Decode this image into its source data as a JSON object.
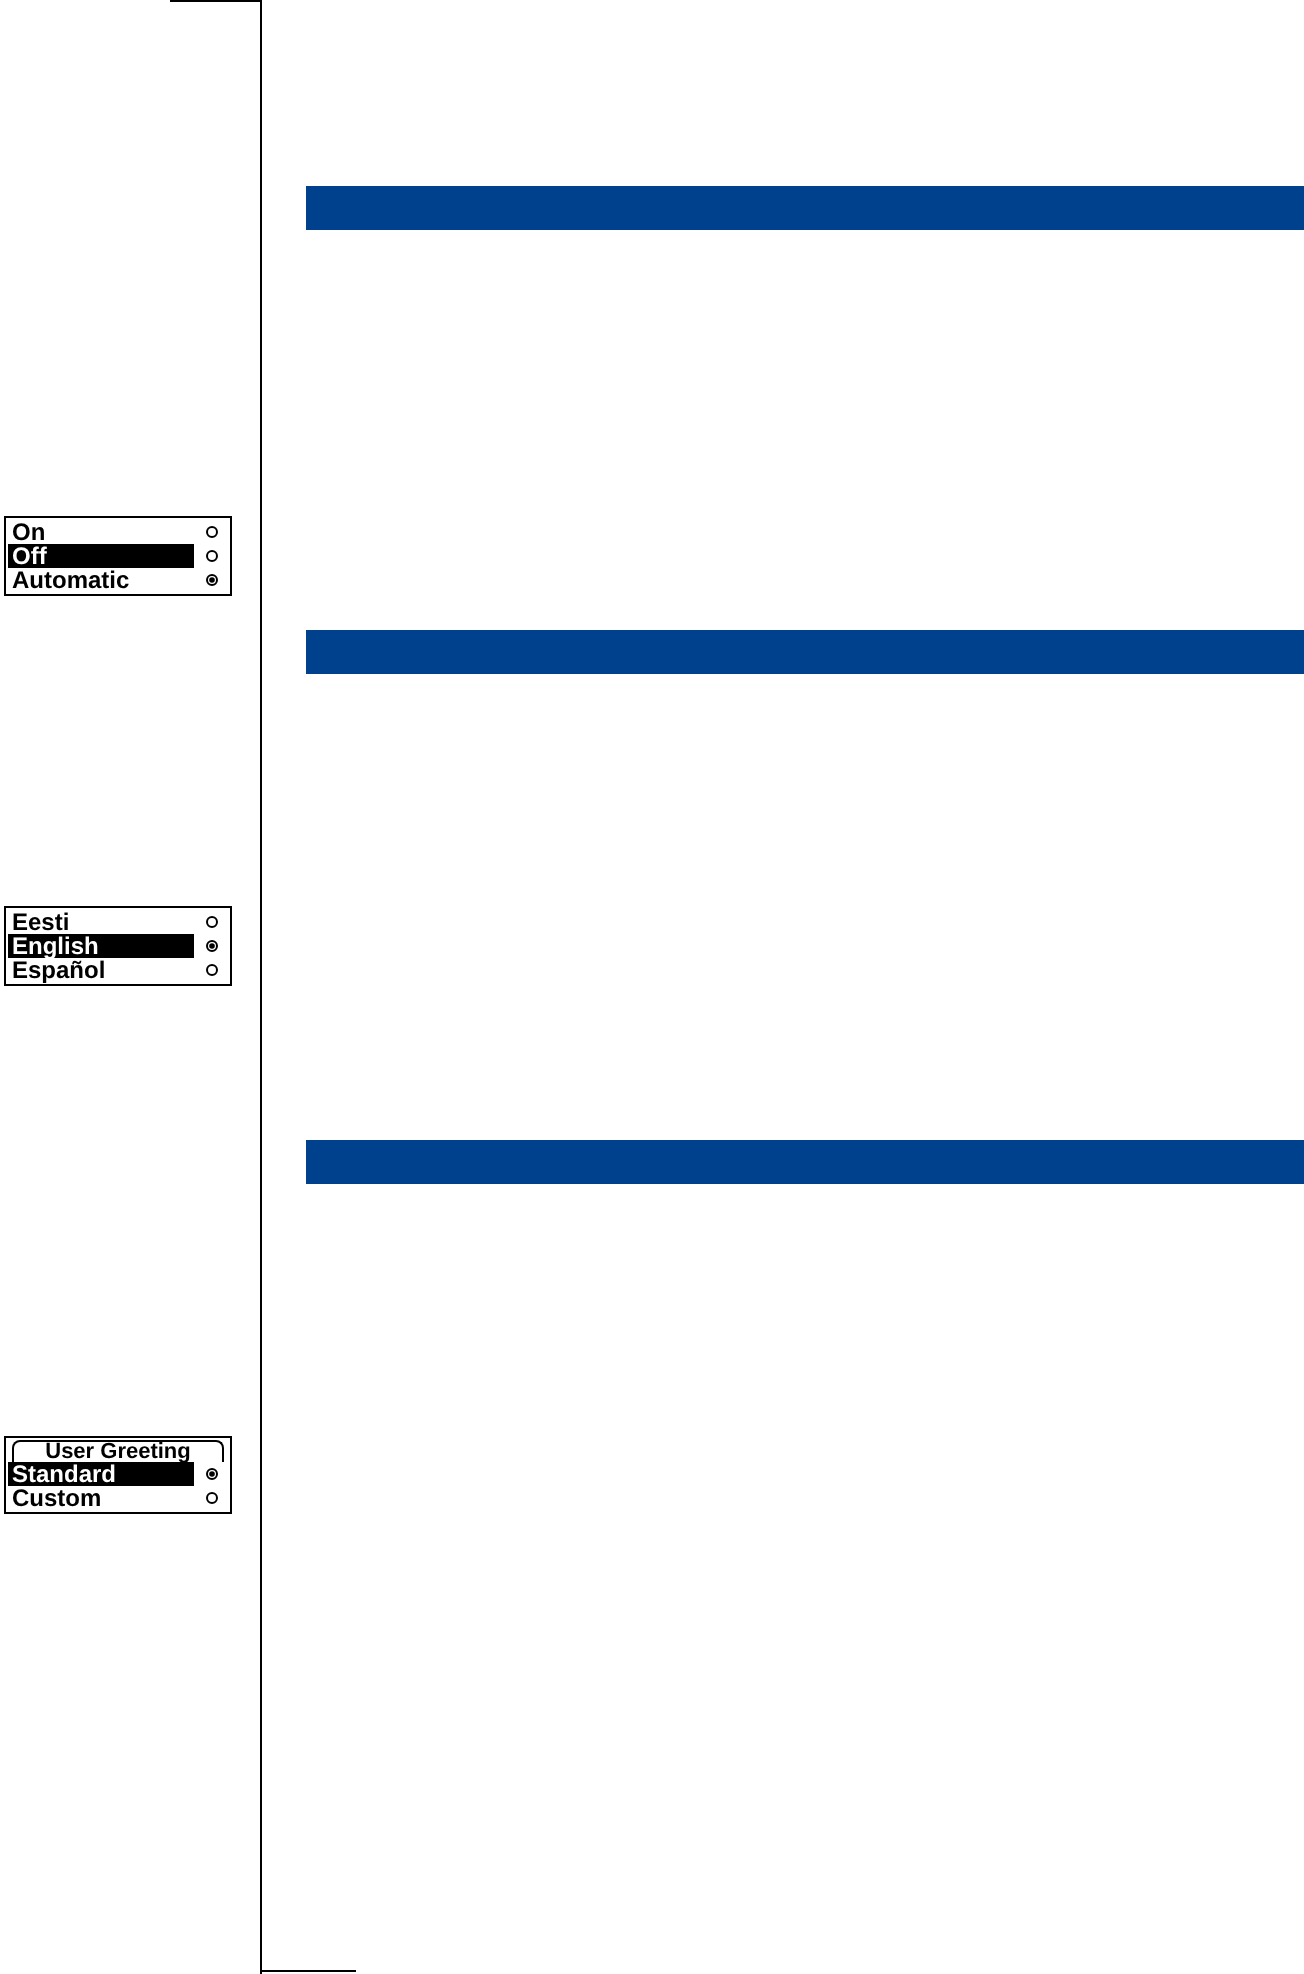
{
  "sections": [
    {
      "screen": {
        "options": [
          {
            "label": "On",
            "highlighted": false,
            "selected": false
          },
          {
            "label": "Off",
            "highlighted": true,
            "selected": false
          },
          {
            "label": "Automatic",
            "highlighted": false,
            "selected": true
          }
        ]
      }
    },
    {
      "screen": {
        "options": [
          {
            "label": "Eesti",
            "highlighted": false,
            "selected": false
          },
          {
            "label": "English",
            "highlighted": true,
            "selected": true
          },
          {
            "label": "Español",
            "highlighted": false,
            "selected": false
          }
        ]
      }
    },
    {
      "screen": {
        "title": "User Greeting",
        "options": [
          {
            "label": "Standard",
            "highlighted": true,
            "selected": true
          },
          {
            "label": "Custom",
            "highlighted": false,
            "selected": false
          }
        ]
      }
    }
  ]
}
